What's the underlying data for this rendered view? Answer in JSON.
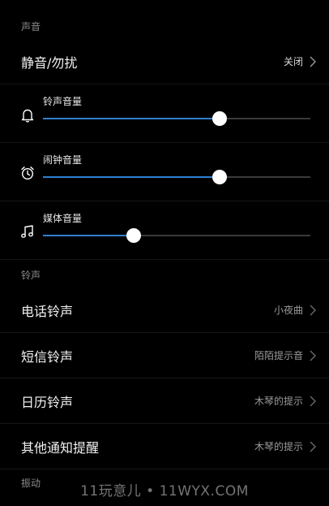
{
  "sections": {
    "sound": "声音",
    "ringtone": "铃声",
    "vibration": "振动"
  },
  "silent_row": {
    "title": "静音/勿扰",
    "value": "关闭"
  },
  "sliders": [
    {
      "label": "铃声音量",
      "icon": "bell-icon",
      "level": 0.66
    },
    {
      "label": "闹钟音量",
      "icon": "alarm-clock-icon",
      "level": 0.66
    },
    {
      "label": "媒体音量",
      "icon": "music-note-icon",
      "level": 0.34
    }
  ],
  "ringtone_rows": [
    {
      "title": "电话铃声",
      "value": "小夜曲"
    },
    {
      "title": "短信铃声",
      "value": "陌陌提示音"
    },
    {
      "title": "日历铃声",
      "value": "木琴的提示"
    },
    {
      "title": "其他通知提醒",
      "value": "木琴的提示"
    }
  ],
  "watermark": "11玩意儿 • 11WYX.COM",
  "colors": {
    "accent": "#2f7fd0",
    "background": "#000000"
  }
}
